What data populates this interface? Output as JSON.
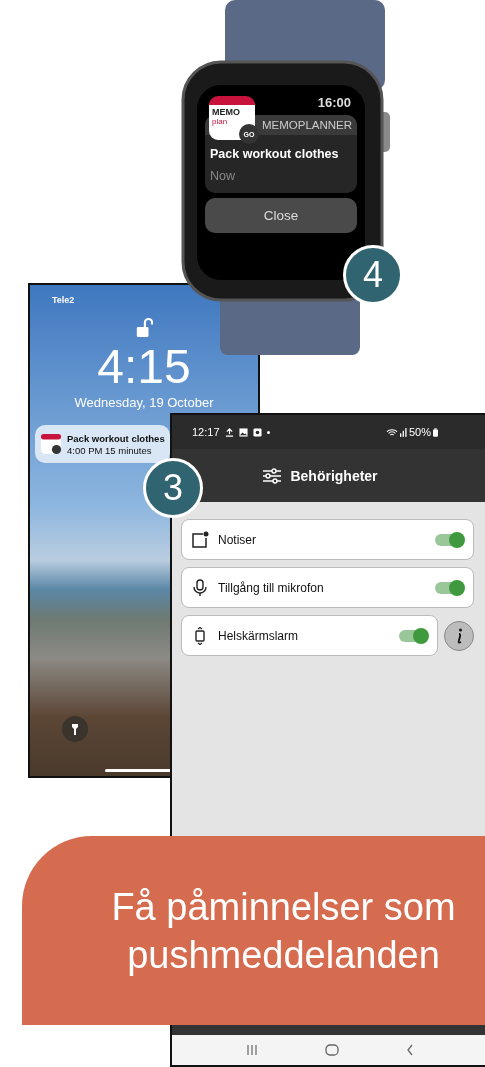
{
  "watch": {
    "time": "16:00",
    "icon_text": [
      "MEMO",
      "plan",
      "GO"
    ],
    "app_name": "MEMOPLANNER",
    "notification_title": "Pack workout clothes",
    "notification_time": "Now",
    "close_button": "Close",
    "step_badge": "4"
  },
  "lock_screen": {
    "carrier": "Tele2",
    "time": "4:15",
    "date": "Wednesday, 19 October",
    "notification": {
      "title": "Pack workout clothes",
      "subtitle": "4:00 PM 15 minutes"
    }
  },
  "android": {
    "status_time": "12:17",
    "battery": "50%",
    "title": "Behörigheter",
    "step_badge": "3",
    "permissions": [
      {
        "kind": "notification",
        "label": "Notiser",
        "on": true,
        "info": false
      },
      {
        "kind": "microphone",
        "label": "Tillgång till mikrofon",
        "on": true,
        "info": false
      },
      {
        "kind": "fullscreen",
        "label": "Helskärmslarm",
        "on": true,
        "info": true
      }
    ]
  },
  "banner": {
    "text": "Få påminnelser som pushmeddelanden"
  }
}
